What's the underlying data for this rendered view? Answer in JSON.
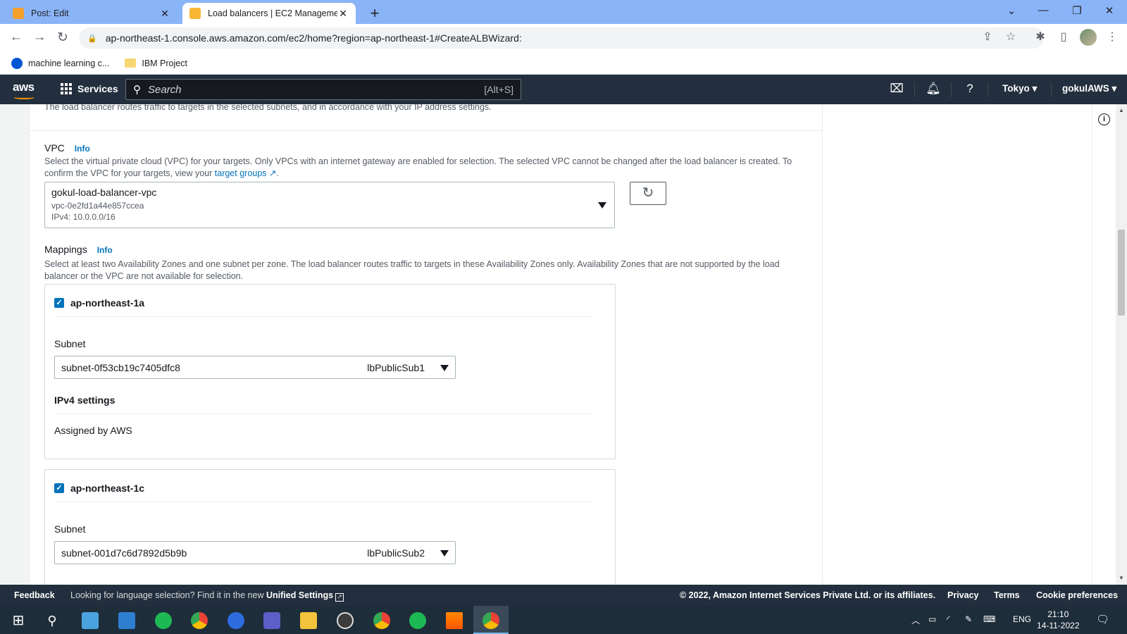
{
  "browser": {
    "tabs": [
      {
        "title": "Post: Edit",
        "favicon": "blogger-icon",
        "active": false
      },
      {
        "title": "Load balancers | EC2 Managemen",
        "favicon": "aws-box-icon",
        "active": true
      }
    ],
    "url": "ap-northeast-1.console.aws.amazon.com/ec2/home?region=ap-northeast-1#CreateALBWizard:",
    "bookmarks": [
      {
        "label": "machine learning c...",
        "icon": "coursera-icon"
      },
      {
        "label": "IBM Project",
        "icon": "folder-icon"
      }
    ]
  },
  "aws_header": {
    "logo": "aws",
    "services_label": "Services",
    "search_placeholder": "Search",
    "search_shortcut": "[Alt+S]",
    "region": "Tokyo",
    "account": "gokulAWS"
  },
  "network": {
    "top_description": "The load balancer routes traffic to targets in the selected subnets, and in accordance with your IP address settings.",
    "vpc": {
      "label": "VPC",
      "info": "Info",
      "help_part1": "Select the virtual private cloud (VPC) for your targets. Only VPCs with an internet gateway are enabled for selection. The selected VPC cannot be changed after the load balancer is created. To confirm the VPC for your targets, view your ",
      "help_link": "target groups",
      "help_end": ".",
      "selected_name": "gokul-load-balancer-vpc",
      "selected_id": "vpc-0e2fd1a44e857ccea",
      "selected_cidr": "IPv4: 10.0.0.0/16"
    },
    "mappings": {
      "label": "Mappings",
      "info": "Info",
      "help": "Select at least two Availability Zones and one subnet per zone. The load balancer routes traffic to targets in these Availability Zones only. Availability Zones that are not supported by the load balancer or the VPC are not available for selection.",
      "zones": [
        {
          "name": "ap-northeast-1a",
          "checked": true,
          "subnet_label": "Subnet",
          "subnet_id": "subnet-0f53cb19c7405dfc8",
          "subnet_name": "lbPublicSub1",
          "ipv4_label": "IPv4 settings",
          "ipv4_value": "Assigned by AWS"
        },
        {
          "name": "ap-northeast-1c",
          "checked": true,
          "subnet_label": "Subnet",
          "subnet_id": "subnet-001d7c6d7892d5b9b",
          "subnet_name": "lbPublicSub2"
        }
      ]
    }
  },
  "footer": {
    "feedback": "Feedback",
    "lang_text": "Looking for language selection? Find it in the new ",
    "lang_link": "Unified Settings",
    "copyright": "© 2022, Amazon Internet Services Private Ltd. or its affiliates.",
    "links": [
      "Privacy",
      "Terms",
      "Cookie preferences"
    ]
  },
  "taskbar": {
    "language": "ENG",
    "time": "21:10",
    "date": "14-11-2022"
  },
  "colors": {
    "aws_nav": "#232f3e",
    "aws_orange": "#ff9900",
    "link_blue": "#0073bb",
    "chrome_tab_bar": "#8ab4f8"
  }
}
